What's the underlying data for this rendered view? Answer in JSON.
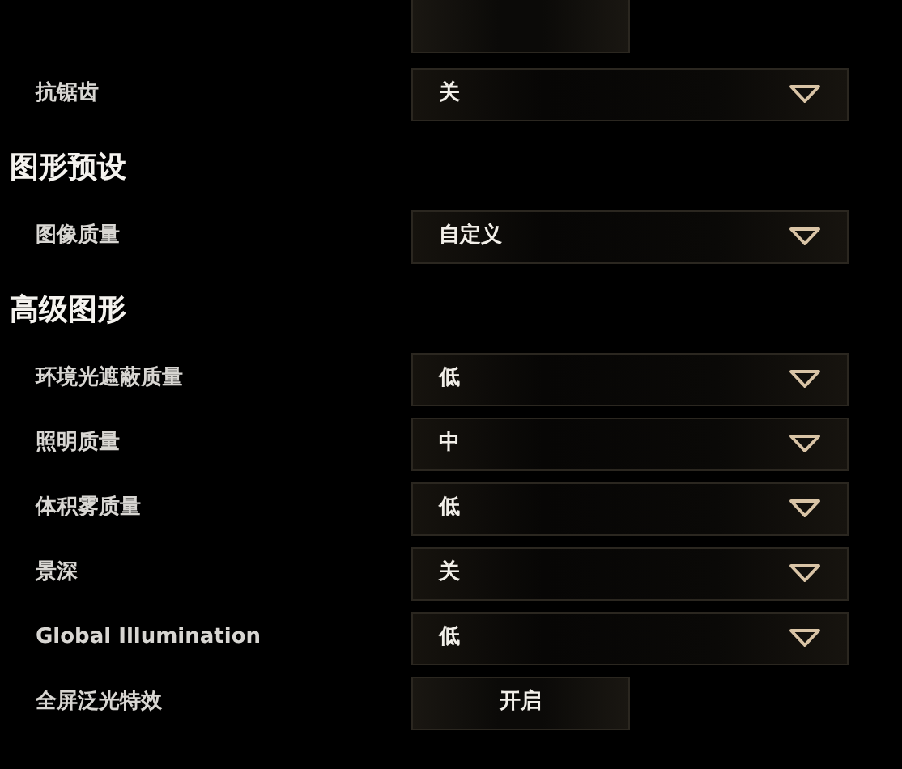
{
  "sections": [
    {
      "rows": [
        {
          "kind": "dropdown",
          "label": "抗锯齿",
          "value": "关"
        }
      ]
    },
    {
      "heading": "图形预设",
      "rows": [
        {
          "kind": "dropdown",
          "label": "图像质量",
          "value": "自定义"
        }
      ]
    },
    {
      "heading": "高级图形",
      "rows": [
        {
          "kind": "dropdown",
          "label": "环境光遮蔽质量",
          "value": "低"
        },
        {
          "kind": "dropdown",
          "label": "照明质量",
          "value": "中"
        },
        {
          "kind": "dropdown",
          "label": "体积雾质量",
          "value": "低"
        },
        {
          "kind": "dropdown",
          "label": "景深",
          "value": "关"
        },
        {
          "kind": "dropdown",
          "label": "Global Illumination",
          "value": "低"
        },
        {
          "kind": "toggle",
          "label": "全屏泛光特效",
          "options": [
            {
              "label": "开启",
              "selected": true
            }
          ]
        }
      ]
    }
  ]
}
